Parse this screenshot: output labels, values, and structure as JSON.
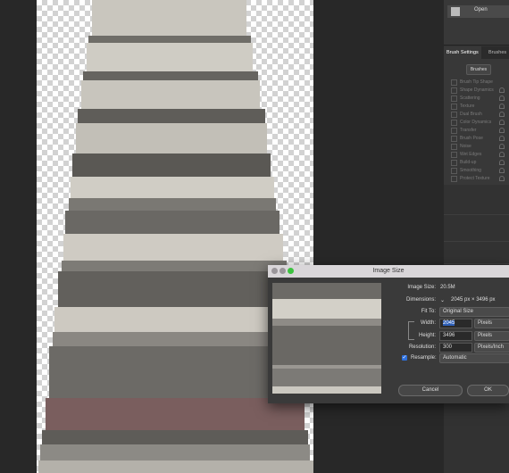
{
  "history": {
    "item_label": "Open"
  },
  "brush_settings": {
    "tabs": [
      "Brush Settings",
      "Brushes"
    ],
    "brushes_button": "Brushes",
    "options": [
      "Brush Tip Shape",
      "Shape Dynamics",
      "Scattering",
      "Texture",
      "Dual Brush",
      "Color Dynamics",
      "Transfer",
      "Brush Pose",
      "Noise",
      "Wet Edges",
      "Build-up",
      "Smoothing",
      "Protect Texture"
    ]
  },
  "image_size_dialog": {
    "title": "Image Size",
    "image_size_label": "Image Size:",
    "image_size_value": "20.5M",
    "dimensions_label": "Dimensions:",
    "dimensions_value": "2045 px  ×  3496 px",
    "fit_to_label": "Fit To:",
    "fit_to_value": "Original Size",
    "width_label": "Width:",
    "width_value": "2045",
    "width_unit": "Pixels",
    "height_label": "Height:",
    "height_value": "3496",
    "height_unit": "Pixels",
    "resolution_label": "Resolution:",
    "resolution_value": "300",
    "resolution_unit": "Pixels/Inch",
    "resample_label": "Resample:",
    "resample_checked": true,
    "resample_value": "Automatic",
    "cancel_button": "Cancel",
    "ok_button": "OK"
  }
}
